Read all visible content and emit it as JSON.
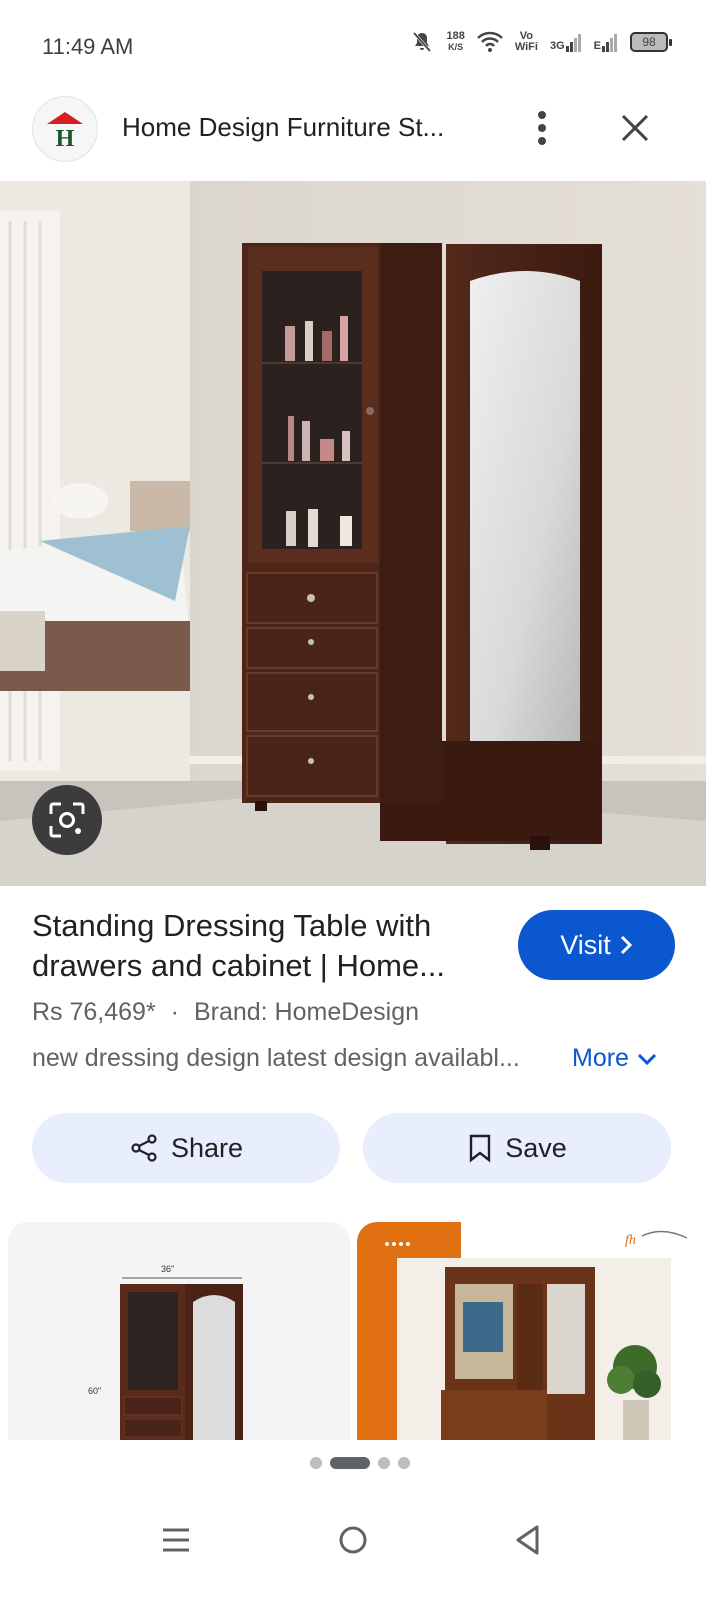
{
  "status_bar": {
    "time": "11:49 AM",
    "data_rate": "188",
    "data_unit": "K/S",
    "volte_top": "Vo",
    "volte_bottom": "WiFi",
    "network_type_1": "3G",
    "network_type_2": "E",
    "battery": "98"
  },
  "header": {
    "site_title": "Home Design Furniture St...",
    "logo_letter": "H"
  },
  "product": {
    "title": "Standing Dressing Table with drawers and cabinet | Home...",
    "visit_label": "Visit",
    "price": "Rs 76,469*",
    "separator": "·",
    "brand": "Brand: HomeDesign",
    "description": "new dressing design latest design availabl...",
    "more_label": "More",
    "share_label": "Share",
    "save_label": "Save"
  },
  "related": {
    "left_width_label": "36\"",
    "left_height_label": "60\"",
    "right_brand": "fh"
  },
  "pager": {
    "total": 4,
    "active_index": 1
  },
  "colors": {
    "accent": "#0b57d0",
    "button_bg": "#e8eefb",
    "wood": "#4a2518"
  }
}
